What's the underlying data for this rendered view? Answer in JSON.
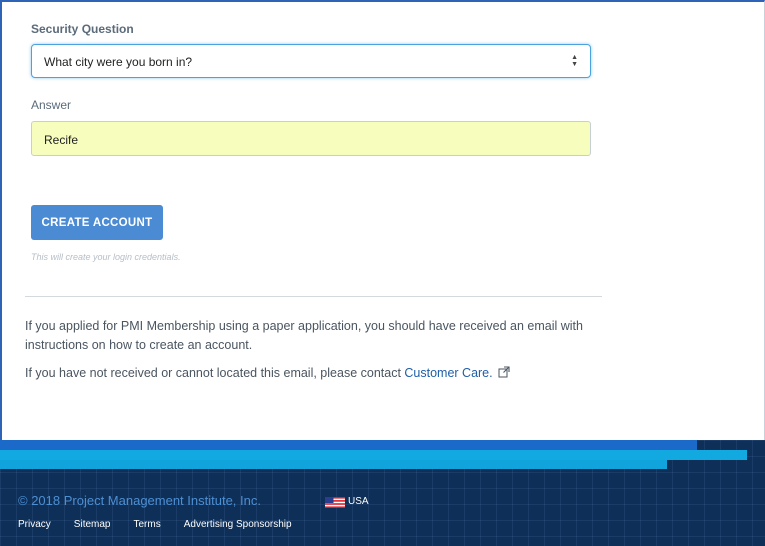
{
  "form": {
    "security_question_label": "Security Question",
    "security_question_value": "What city were you born in?",
    "answer_label": "Answer",
    "answer_value": "Recife",
    "create_button_label": "CREATE ACCOUNT",
    "create_hint": "This will create your login credentials."
  },
  "info": {
    "paper_application_text": "If you applied for PMI Membership using a paper application, you should have received an email with instructions on how to create an account.",
    "contact_text_prefix": "If you have not received or cannot located this email, please contact ",
    "customer_care_link": "Customer Care."
  },
  "footer": {
    "copyright": "© 2018 Project Management Institute, Inc.",
    "country": "USA",
    "links": [
      "Privacy",
      "Sitemap",
      "Terms",
      "Advertising Sponsorship"
    ]
  },
  "colors": {
    "primary_button": "#4b8bd4",
    "answer_autofill_bg": "#f7fdbd",
    "link": "#1f5fa8",
    "footer_bg": "#0d2f58"
  }
}
